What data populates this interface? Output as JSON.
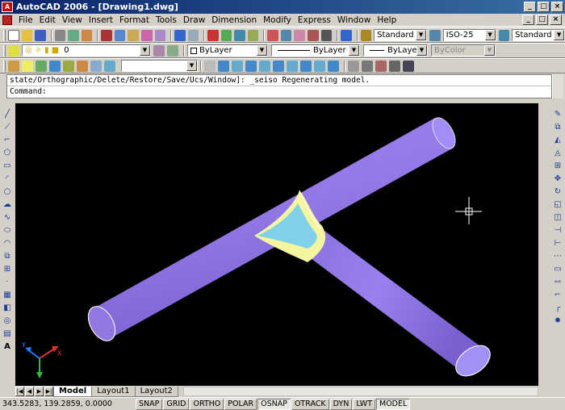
{
  "window": {
    "title": "AutoCAD 2006 - [Drawing1.dwg]",
    "min": "_",
    "max": "□",
    "close": "×"
  },
  "menu": [
    "File",
    "Edit",
    "View",
    "Insert",
    "Format",
    "Tools",
    "Draw",
    "Dimension",
    "Modify",
    "Express",
    "Window",
    "Help"
  ],
  "standard_toolbar": {
    "text_style": "Standard",
    "dim_style": "ISO-25",
    "table_style": "Standard"
  },
  "layers_toolbar": {
    "layer": "0",
    "color": "ByLayer",
    "linetype": "ByLayer",
    "lineweight": "ByLayer",
    "plotstyle": "ByColor"
  },
  "command": {
    "history": "state/Orthographic/Delete/Restore/Save/Ucs/Window]: _seiso Regenerating model.",
    "prompt": "Command:"
  },
  "tabs": [
    "Model",
    "Layout1",
    "Layout2"
  ],
  "status": {
    "coords": "343.5283, 139.2859, 0.0000",
    "buttons": [
      "SNAP",
      "GRID",
      "ORTHO",
      "POLAR",
      "OSNAP",
      "OTRACK",
      "DYN",
      "LWT",
      "MODEL"
    ],
    "on": [
      "OSNAP",
      "MODEL"
    ]
  },
  "ucs": {
    "x": "X",
    "y": "Y"
  },
  "colors": {
    "pipe": "#9478e6",
    "fillet": "#f5f5a0",
    "face": "#7fd0e8",
    "viewport_bg": "#000000"
  }
}
